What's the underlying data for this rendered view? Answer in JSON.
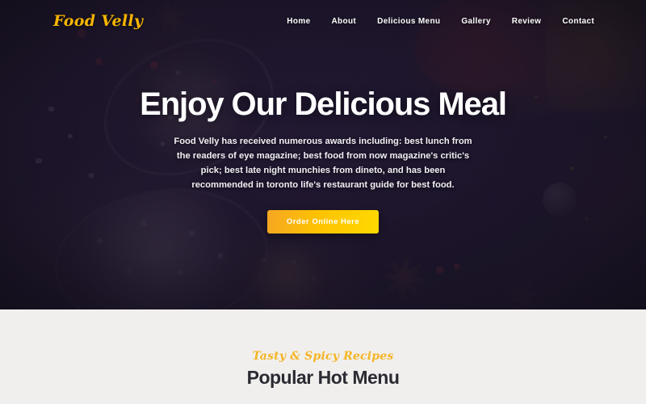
{
  "header": {
    "logo": "Food Velly",
    "nav": [
      {
        "label": "Home"
      },
      {
        "label": "About"
      },
      {
        "label": "Delicious Menu"
      },
      {
        "label": "Gallery"
      },
      {
        "label": "Review"
      },
      {
        "label": "Contact"
      }
    ]
  },
  "hero": {
    "title": "Enjoy Our Delicious Meal",
    "paragraph": "Food Velly has received numerous awards including: best lunch from the readers of eye magazine; best food from now magazine's critic's pick; best late night munchies from dineto, and has been recommended in toronto life's restaurant guide for best food.",
    "cta_label": "Order Online Here"
  },
  "menu_section": {
    "eyebrow": "Tasty & Spicy Recipes",
    "title": "Popular Hot Menu"
  },
  "colors": {
    "brand_gold": "#f7b500",
    "cta_gradient_start": "#f5a623",
    "cta_gradient_end": "#ffd900",
    "hero_overlay": "#1a1326",
    "section_bg": "#f1efed",
    "heading_dark": "#2b2b33",
    "nav_text": "#ffffff"
  }
}
